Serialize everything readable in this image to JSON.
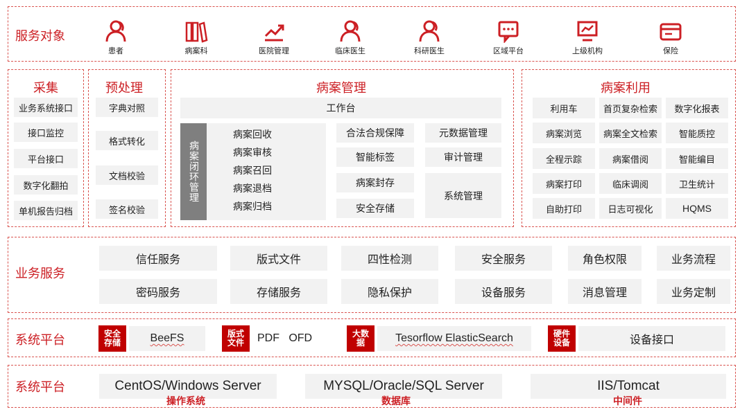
{
  "service_targets": {
    "title": "服务对象",
    "items": [
      {
        "label": "患者",
        "icon": "person-icon"
      },
      {
        "label": "病案科",
        "icon": "books-icon"
      },
      {
        "label": "医院管理",
        "icon": "chart-icon"
      },
      {
        "label": "临床医生",
        "icon": "person-icon"
      },
      {
        "label": "科研医生",
        "icon": "person-icon"
      },
      {
        "label": "区域平台",
        "icon": "chat-screen-icon"
      },
      {
        "label": "上级机构",
        "icon": "monitor-chart-icon"
      },
      {
        "label": "保险",
        "icon": "card-icon"
      }
    ]
  },
  "collect": {
    "title": "采集",
    "items": [
      "业务系统接口",
      "接口监控",
      "平台接口",
      "数字化翻拍",
      "单机报告归档"
    ]
  },
  "preprocess": {
    "title": "预处理",
    "items": [
      "字典对照",
      "格式转化",
      "文档校验",
      "签名校验"
    ]
  },
  "record_mgmt": {
    "title": "病案管理",
    "workbench": "工作台",
    "loop_label": "病案闭环管理",
    "loop_items": [
      "病案回收",
      "病案审核",
      "病案召回",
      "病案退档",
      "病案归档"
    ],
    "mid_items": [
      "合法合规保障",
      "智能标签",
      "病案封存",
      "安全存储"
    ],
    "right_items": [
      "元数据管理",
      "审计管理",
      "系统管理"
    ]
  },
  "record_use": {
    "title": "病案利用",
    "grid": [
      [
        "利用车",
        "首页复杂检索",
        "数字化报表"
      ],
      [
        "病案浏览",
        "病案全文检索",
        "智能质控"
      ],
      [
        "全程示踪",
        "病案借阅",
        "智能编目"
      ],
      [
        "病案打印",
        "临床调阅",
        "卫生统计"
      ],
      [
        "自助打印",
        "日志可视化",
        "HQMS"
      ]
    ]
  },
  "biz_services": {
    "title": "业务服务",
    "row1": [
      "信任服务",
      "版式文件",
      "四性检测",
      "安全服务",
      "角色权限",
      "业务流程"
    ],
    "row2": [
      "密码服务",
      "存储服务",
      "隐私保护",
      "设备服务",
      "消息管理",
      "业务定制"
    ]
  },
  "platform1": {
    "title": "系统平台",
    "groups": [
      {
        "tag": "安全存储",
        "content": "BeeFS"
      },
      {
        "tag": "版式文件",
        "content": "PDF   OFD"
      },
      {
        "tag": "大数据",
        "content": "Tesorflow ElasticSearch"
      },
      {
        "tag": "硬件设备",
        "content": "设备接口"
      }
    ]
  },
  "platform2": {
    "title": "系统平台",
    "groups": [
      {
        "content": "CentOS/Windows Server",
        "label": "操作系统"
      },
      {
        "content": "MYSQL/Oracle/SQL Server",
        "label": "数据库"
      },
      {
        "content": "IIS/Tomcat",
        "label": "中间件"
      }
    ]
  },
  "colors": {
    "accent": "#cc1f24",
    "box": "#f2f2f2",
    "tag": "#c00000",
    "loop": "#7f7f7f"
  }
}
